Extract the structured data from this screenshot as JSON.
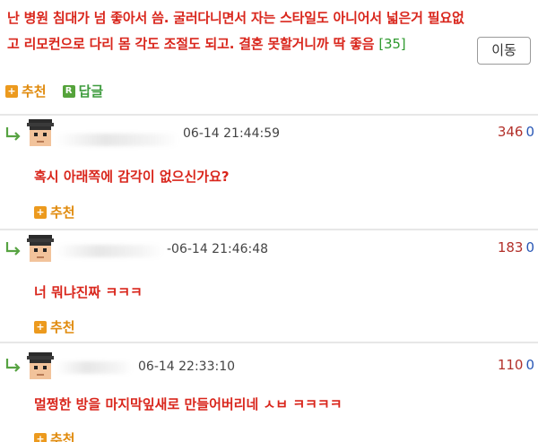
{
  "post": {
    "line1": "난 병원 침대가 넘 좋아서 씀. 굴러다니면서 자는 스타일도 아니어서 넓은거 필요없",
    "line2": "고 리모컨으로 다리 몸 각도 조절도 되고. 결혼 못할거니까 딱 좋음",
    "comment_count": "[35]",
    "move_button": "이동",
    "recommend": "추천",
    "reply": "답글"
  },
  "icons": {
    "plus": "+",
    "reply_r": "R"
  },
  "comments": [
    {
      "date": "06-14 21:44:59",
      "num1": "346",
      "num2": "0",
      "text": "혹시 아래쪽에 감각이 없으신가요?",
      "recommend": "추천"
    },
    {
      "date": "-06-14 21:46:48",
      "num1": "183",
      "num2": "0",
      "text": "너 뭐냐진짜 ㅋㅋㅋ",
      "recommend": "추천"
    },
    {
      "date": "06-14 22:33:10",
      "num1": "110",
      "num2": "0",
      "text": "멀쩡한 방을 마지막잎새로 만들어버리네 ㅅㅂ ㅋㅋㅋㅋ",
      "recommend": "추천"
    }
  ],
  "colors": {
    "accent_red": "#d9261c",
    "recommend_orange": "#ec9a1e",
    "reply_green": "#55a33b",
    "count_blue": "#2a58b6"
  }
}
